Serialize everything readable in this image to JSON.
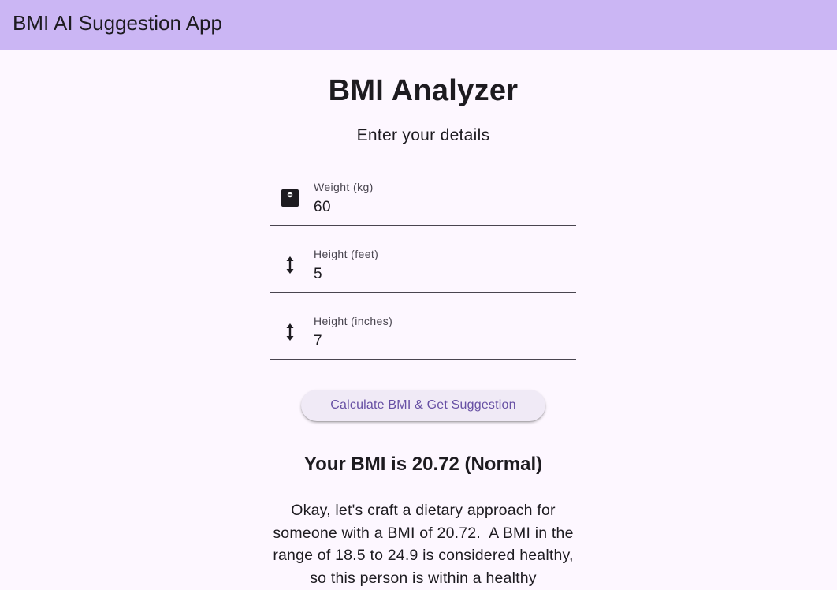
{
  "appbar": {
    "title": "BMI AI Suggestion App",
    "background": "#cbb6f4"
  },
  "main": {
    "title": "BMI Analyzer",
    "subtitle": "Enter your details"
  },
  "form": {
    "weight": {
      "label": "Weight (kg)",
      "value": "60",
      "icon": "scale-icon"
    },
    "height_feet": {
      "label": "Height (feet)",
      "value": "5",
      "icon": "height-arrow-icon"
    },
    "height_inches": {
      "label": "Height (inches)",
      "value": "7",
      "icon": "height-arrow-icon"
    },
    "submit_label": "Calculate BMI & Get Suggestion"
  },
  "result": {
    "bmi_text": "Your BMI is 20.72 (Normal)",
    "suggestion_text": "Okay, let's craft a dietary approach for someone with a BMI of 20.72.  A BMI in the range of 18.5 to 24.9 is considered healthy, so this person is within a healthy"
  },
  "colors": {
    "accent": "#6750a4",
    "page_background": "#fdf7ff",
    "button_background": "#f0eaf6"
  }
}
